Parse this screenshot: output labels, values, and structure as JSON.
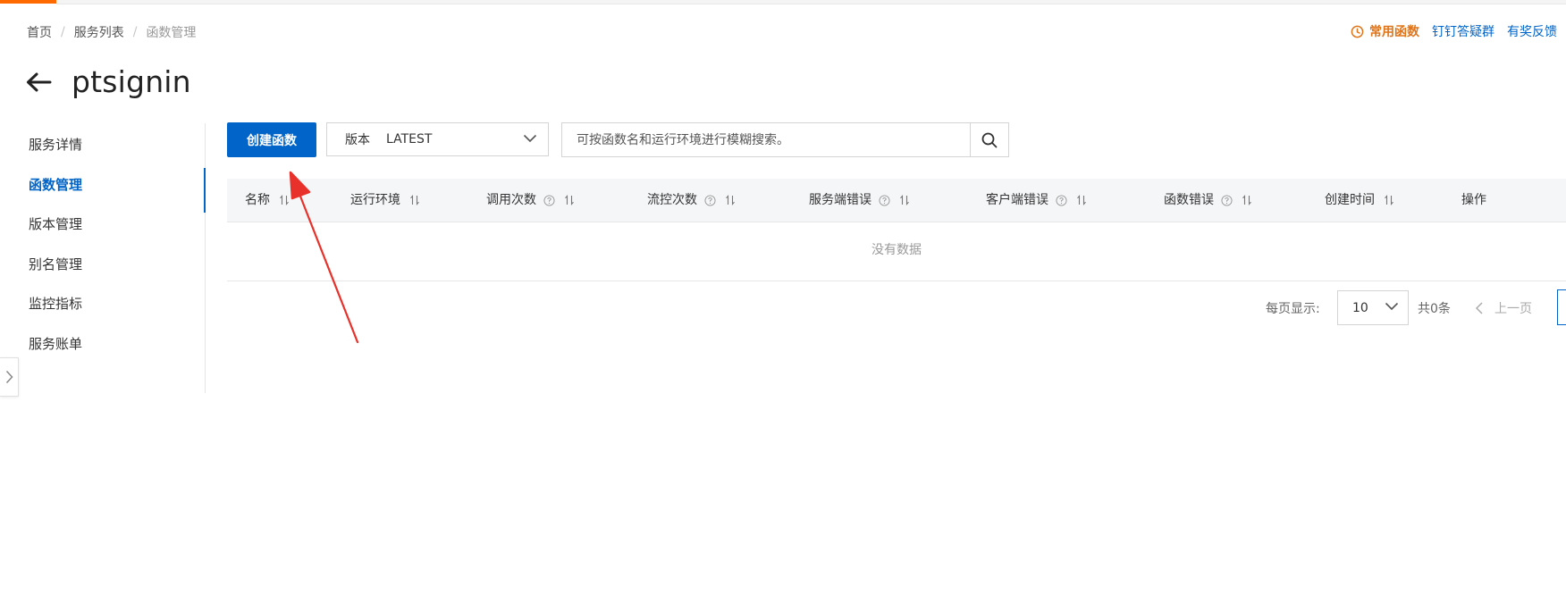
{
  "breadcrumb": {
    "home": "首页",
    "services": "服务列表",
    "current": "函数管理",
    "separator": "/"
  },
  "toplinks": {
    "favorite": "常用函数",
    "dingtalk": "钉钉答疑群",
    "feedback": "有奖反馈"
  },
  "page_title": "ptsignin",
  "sidebar": {
    "items": [
      {
        "label": "服务详情"
      },
      {
        "label": "函数管理",
        "active": true
      },
      {
        "label": "版本管理"
      },
      {
        "label": "别名管理"
      },
      {
        "label": "监控指标"
      },
      {
        "label": "服务账单"
      }
    ]
  },
  "toolbar": {
    "create_label": "创建函数",
    "version_label": "版本",
    "version_value": "LATEST",
    "search_placeholder": "可按函数名和运行环境进行模糊搜索。"
  },
  "table": {
    "columns": [
      {
        "label": "名称",
        "help": false,
        "sort": true
      },
      {
        "label": "运行环境",
        "help": false,
        "sort": true
      },
      {
        "label": "调用次数",
        "help": true,
        "sort": true
      },
      {
        "label": "流控次数",
        "help": true,
        "sort": true
      },
      {
        "label": "服务端错误",
        "help": true,
        "sort": true
      },
      {
        "label": "客户端错误",
        "help": true,
        "sort": true
      },
      {
        "label": "函数错误",
        "help": true,
        "sort": true
      },
      {
        "label": "创建时间",
        "help": false,
        "sort": true
      },
      {
        "label": "操作",
        "help": false,
        "sort": false
      }
    ],
    "empty_text": "没有数据"
  },
  "pagination": {
    "per_page_label": "每页显示:",
    "per_page_value": "10",
    "total": "共0条",
    "prev": "上一页"
  },
  "colors": {
    "primary": "#0064c8",
    "accent_orange": "#ff6a00",
    "favorite_orange": "#e07419",
    "annotation_red": "#e8312a"
  }
}
